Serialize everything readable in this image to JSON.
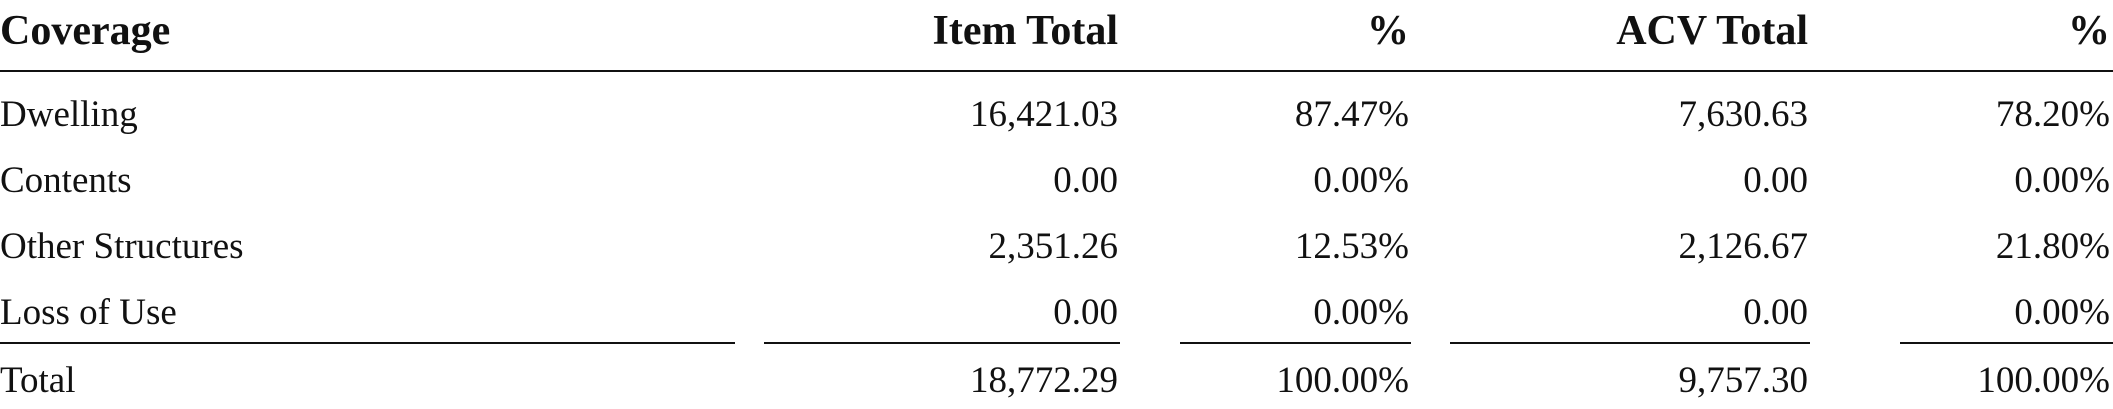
{
  "table": {
    "headers": [
      "Coverage",
      "Item Total",
      "%",
      "ACV Total",
      "%"
    ],
    "rows": [
      [
        "Dwelling",
        "16,421.03",
        "87.47%",
        "7,630.63",
        "78.20%"
      ],
      [
        "Contents",
        "0.00",
        "0.00%",
        "0.00",
        "0.00%"
      ],
      [
        "Other Structures",
        "2,351.26",
        "12.53%",
        "2,126.67",
        "21.80%"
      ],
      [
        "Loss of Use",
        "0.00",
        "0.00%",
        "0.00",
        "0.00%"
      ]
    ],
    "total": [
      "Total",
      "18,772.29",
      "100.00%",
      "9,757.30",
      "100.00%"
    ]
  }
}
